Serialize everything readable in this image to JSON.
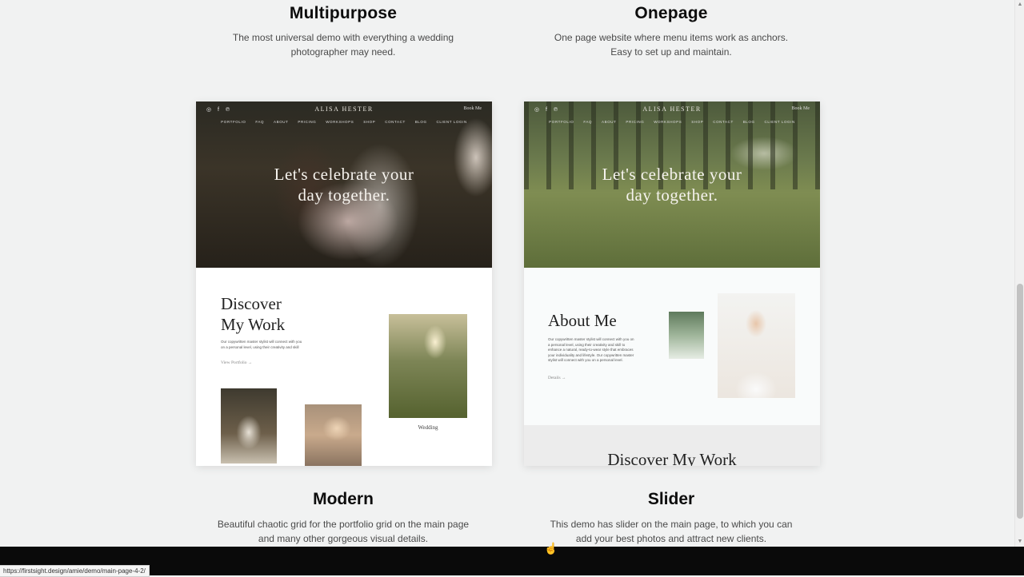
{
  "demos_top": [
    {
      "title": "Multipurpose",
      "desc": "The most universal demo with everything a wedding photographer may need."
    },
    {
      "title": "Onepage",
      "desc": "One page website where menu items work as anchors. Easy to set up and maintain."
    }
  ],
  "preview": {
    "brand": "ALISA HESTER",
    "book": "Book Me",
    "social": "◎ f ℗",
    "nav": [
      "PORTFOLIO",
      "FAQ",
      "ABOUT",
      "PRICING",
      "WORKSHOPS",
      "SHOP",
      "CONTACT",
      "BLOG",
      "CLIENT LOGIN"
    ],
    "hero_heading": "Let's celebrate your day together."
  },
  "multi": {
    "section_heading": "Discover My Work",
    "section_text": "Our copywritten master stylist will connect with you on a personal level, using their creativity and skill",
    "link": "View Portfolio →",
    "photo_caption": "Wedding"
  },
  "one": {
    "section_heading": "About Me",
    "section_text": "Our copywritten master stylist will connect with you on a personal level, using their creativity and skill to enhance a natural, ready-to-wear style that embraces your individuality and lifestyle. Our copywritten master stylist will connect with you on a personal level.",
    "link": "Details →",
    "band_heading": "Discover My Work"
  },
  "demos_bottom": [
    {
      "title": "Modern",
      "desc": "Beautiful chaotic grid for the portfolio grid on the main page and many other gorgeous visual details."
    },
    {
      "title": "Slider",
      "desc": "This demo has slider on the main page, to which you can add your best photos and attract new clients."
    }
  ],
  "status_url": "https://firstsight.design/amie/demo/main-page-4-2/"
}
